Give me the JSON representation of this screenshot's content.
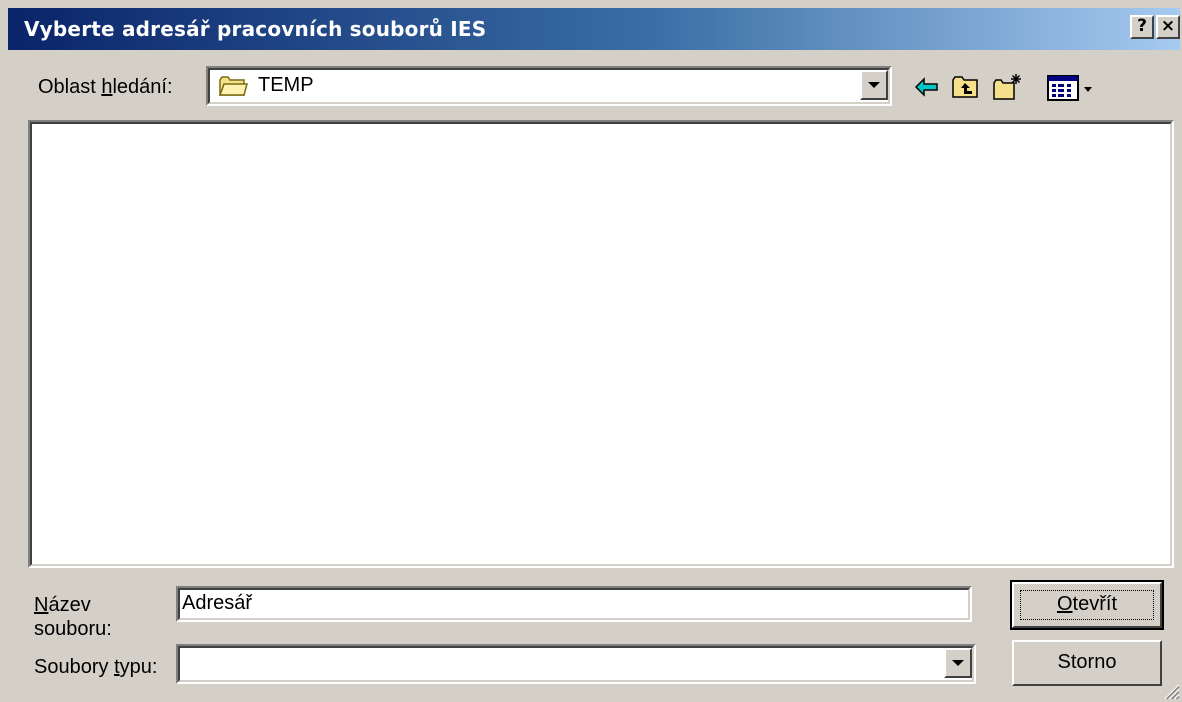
{
  "window": {
    "title": "Vyberte adresář pracovních souborů IES",
    "help_button": "?",
    "close_button": "×"
  },
  "lookin": {
    "label_pre": "Oblast ",
    "label_mnemonic": "h",
    "label_post": "ledání:",
    "value": "TEMP"
  },
  "toolbar": {
    "icons": [
      "back-icon",
      "up-folder-icon",
      "new-folder-icon",
      "view-menu-icon"
    ]
  },
  "filename": {
    "label_mnemonic": "N",
    "label_line1_rest": "ázev",
    "label_line2": "souboru:",
    "value": "Adresář"
  },
  "filetype": {
    "label_pre": "Soubory ",
    "label_mnemonic": "t",
    "label_post": "ypu:",
    "value": ""
  },
  "buttons": {
    "open_mnemonic": "O",
    "open_rest": "tevřít",
    "cancel": "Storno"
  },
  "colors": {
    "titlebar_start": "#0a246a",
    "titlebar_end": "#a6caf0",
    "face": "#d4d0c8"
  }
}
